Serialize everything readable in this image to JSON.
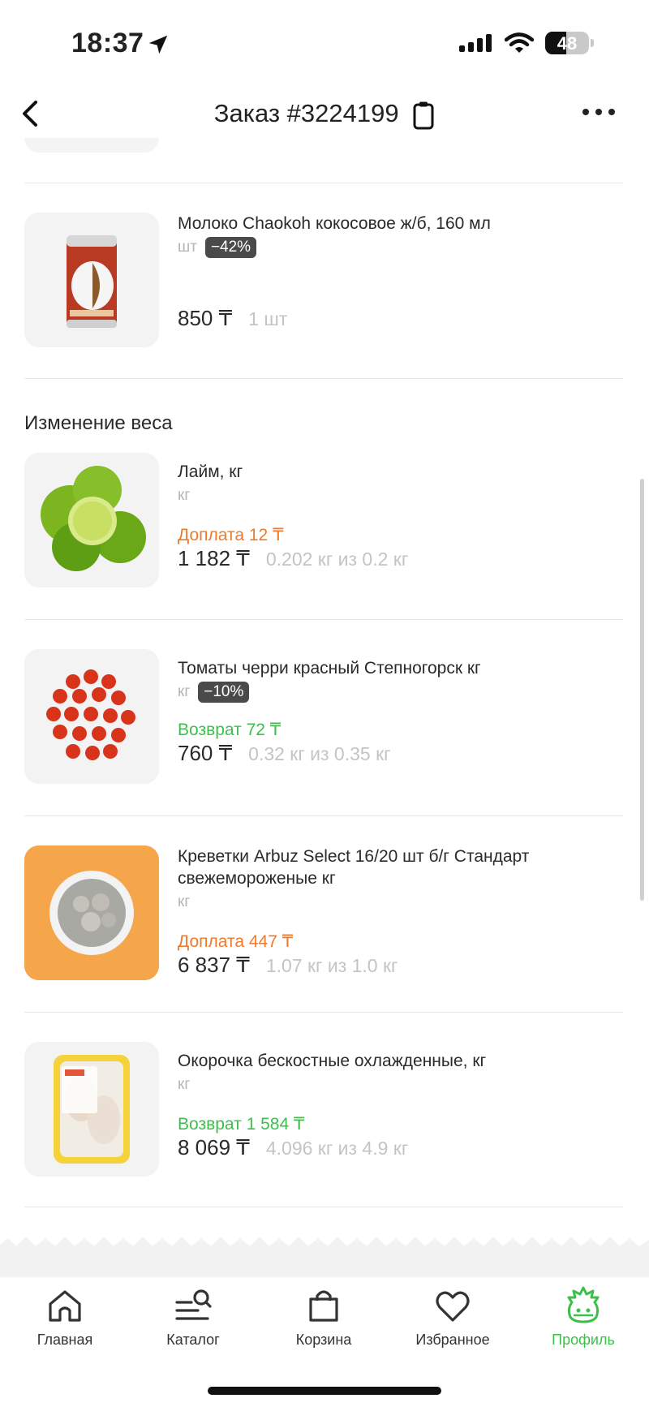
{
  "status_bar": {
    "time": "18:37",
    "battery": "48",
    "battery_level": 0.48
  },
  "header": {
    "title": "Заказ #3224199"
  },
  "items": [
    {
      "name": "Молоко Chaokoh кокосовое  ж/б, 160 мл",
      "unit": "шт",
      "badge": "−42%",
      "price": "850 ₸",
      "qty": "1 шт"
    }
  ],
  "weight_section": {
    "title": "Изменение веса",
    "items": [
      {
        "name": "Лайм, кг",
        "unit": "кг",
        "adjustment": "Доплата 12 ₸",
        "adjustment_type": "surcharge",
        "price": "1 182 ₸",
        "qty": "0.202 кг из 0.2 кг"
      },
      {
        "name": "Томаты черри красный Степногорск кг",
        "unit": "кг",
        "badge": "−10%",
        "adjustment": "Возврат 72 ₸",
        "adjustment_type": "refund",
        "price": "760 ₸",
        "qty": "0.32 кг из 0.35 кг"
      },
      {
        "name": "Креветки Arbuz Select 16/20 шт б/г Стандарт свежемороженые кг",
        "unit": "кг",
        "adjustment": "Доплата 447 ₸",
        "adjustment_type": "surcharge",
        "price": "6 837 ₸",
        "qty": "1.07 кг из 1.0 кг"
      },
      {
        "name": "Окорочка бескостные охлажденные, кг",
        "unit": "кг",
        "adjustment": "Возврат 1 584 ₸",
        "adjustment_type": "refund",
        "price": "8 069 ₸",
        "qty": "4.096 кг из 4.9 кг"
      }
    ]
  },
  "tabbar": {
    "tabs": [
      {
        "label": "Главная",
        "icon": "home-icon"
      },
      {
        "label": "Каталог",
        "icon": "catalog-search-icon"
      },
      {
        "label": "Корзина",
        "icon": "bag-icon"
      },
      {
        "label": "Избранное",
        "icon": "heart-icon"
      },
      {
        "label": "Профиль",
        "icon": "profile-mascot-icon",
        "active": true
      }
    ]
  },
  "colors": {
    "accent_green": "#3dbf4c",
    "surcharge_orange": "#f07a2a",
    "badge_dark": "#4a4a4a"
  }
}
